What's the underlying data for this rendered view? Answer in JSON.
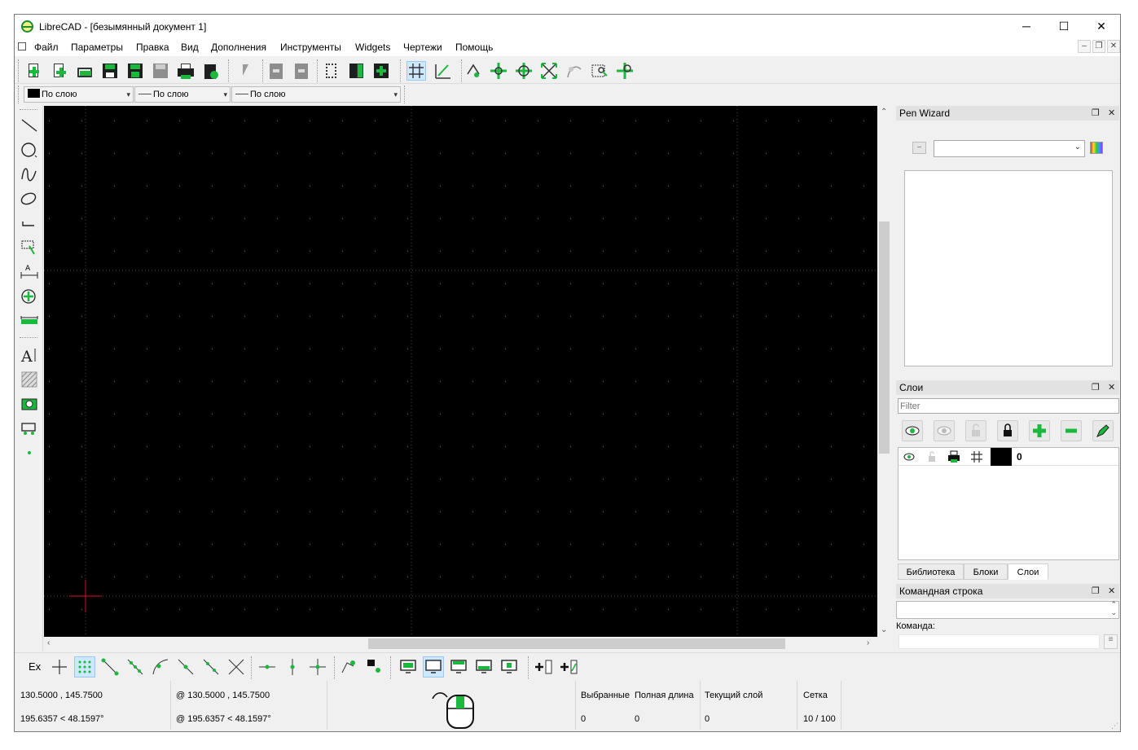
{
  "window": {
    "title": "LibreCAD - [безымянный документ 1]",
    "minimize": "─",
    "maximize": "☐",
    "close": "✕"
  },
  "menu": [
    "Файл",
    "Параметры",
    "Правка",
    "Вид",
    "Дополнения",
    "Инструменты",
    "Widgets",
    "Чертежи",
    "Помощь"
  ],
  "pen_toolbar": {
    "color": "По слою",
    "width": "По слою",
    "linetype": "По слою"
  },
  "pen_wizard": {
    "title": "Pen Wizard",
    "minus": "−"
  },
  "layers": {
    "title": "Слои",
    "filter_placeholder": "Filter",
    "rows": [
      {
        "name": "0"
      }
    ],
    "tabs": [
      "Библиотека",
      "Блоки",
      "Слои"
    ],
    "active_tab": "Слои"
  },
  "command": {
    "title": "Командная строка",
    "label": "Команда:"
  },
  "snap": {
    "ex_label": "Ex"
  },
  "status": {
    "abs_cart": "130.5000 , 145.7500",
    "abs_polar": "195.6357 < 48.1597°",
    "rel_cart": "@  130.5000 , 145.7500",
    "rel_polar": "@  195.6357 < 48.1597°",
    "selected_label": "Выбранные",
    "selected_value": "0",
    "total_length_label": "Полная длина",
    "total_length_value": "0",
    "current_layer_label": "Текущий слой",
    "current_layer_value": "0",
    "grid_label": "Сетка",
    "grid_value": "10 / 100"
  },
  "colors": {
    "accent": "#1bb83e",
    "canvas_bg": "#000000",
    "grid_dot": "#6a6a6a",
    "origin_marker": "#d8101e"
  }
}
